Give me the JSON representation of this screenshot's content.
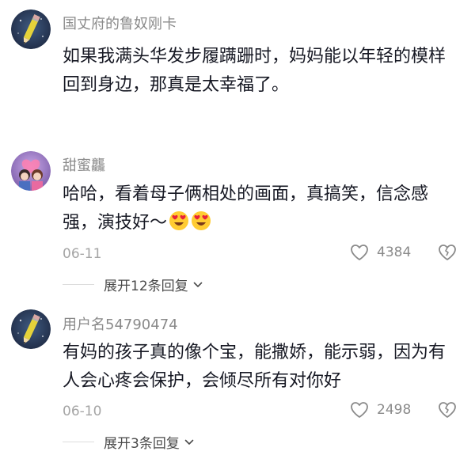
{
  "comments": [
    {
      "username": "国丈府的鲁奴刚卡",
      "lines": [
        "如果我满头华发步履蹒跚时，妈妈能以年轻的模样",
        "回到身边，那真是太幸福了。"
      ],
      "avatar_icon": "pencil-avatar-icon"
    },
    {
      "username": "甜蜜龘",
      "lines": [
        "哈哈，看着母子俩相处的画面，真搞笑，信念感",
        "强，演技好～"
      ],
      "emoji": [
        "heart-eyes-emoji",
        "heart-eyes-emoji"
      ],
      "date": "06-11",
      "likes": "4384",
      "expand_label": "展开12条回复",
      "avatar_icon": "couple-avatar-icon"
    },
    {
      "username": "用户名54790474",
      "lines": [
        "有妈的孩子真的像个宝，能撒娇，能示弱，因为有",
        "人会心疼会保护，会倾尽所有对你好"
      ],
      "date": "06-10",
      "likes": "2498",
      "expand_label": "展开3条回复",
      "avatar_icon": "pencil-avatar-icon"
    }
  ],
  "colors": {
    "text": "#161823",
    "meta": "#8a8a8a",
    "avatar_bg": "#2b3a55",
    "pencil": "#e5d23a"
  }
}
